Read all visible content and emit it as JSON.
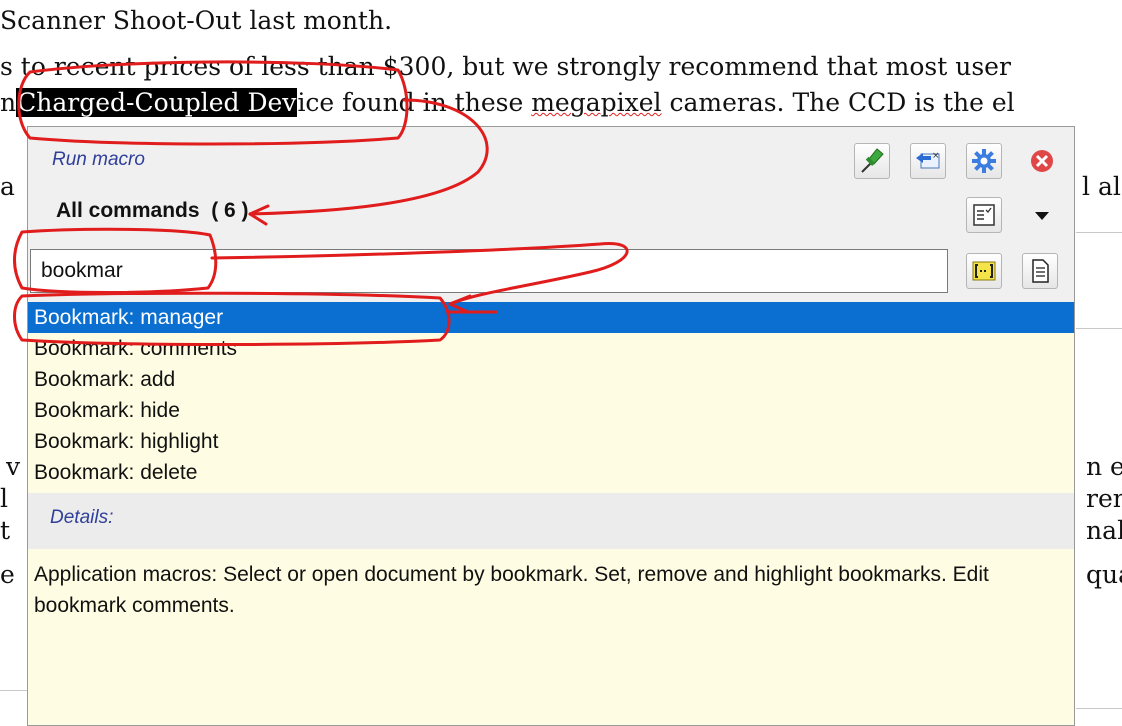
{
  "document": {
    "line1": "Scanner Shoot-Out last month.",
    "line2": "s to recent prices of less than $300, but we strongly recommend that most user",
    "line3_prefix": "n",
    "line3_selected": "Charged-Coupled Dev",
    "line3_mid": "ice found in these ",
    "line3_squiggle": "megapixel",
    "line3_suffix": " cameras. The CCD is the el",
    "frag_left_4": "a",
    "frag_right_4": "l als",
    "frag_left_5": "v",
    "frag_right_5": "n ec",
    "frag_left_6": "l",
    "frag_right_6": "ren",
    "frag_left_7": "t",
    "frag_right_7": "nah",
    "frag_left_8": "e",
    "frag_right_8": "qua"
  },
  "panel": {
    "title": "Run macro",
    "list_header": "All commands",
    "list_count": "( 6 )",
    "search_value": "bookmar",
    "commands": [
      "Bookmark: manager",
      "Bookmark: comments",
      "Bookmark: add",
      "Bookmark: hide",
      "Bookmark: highlight",
      "Bookmark: delete"
    ],
    "details_label": "Details:",
    "description": "Application macros: Select or open document by bookmark. Set, remove and highlight bookmarks. Edit bookmark comments."
  },
  "icons": {
    "pin": "pin-icon",
    "back": "back-arrow-icon",
    "settings": "gear-icon",
    "close": "close-icon",
    "list_options": "list-options-icon",
    "dropdown": "chevron-down-icon",
    "bracket": "bracket-icon",
    "document": "document-icon"
  },
  "colors": {
    "selection": "#0a6fd0",
    "panel_bg": "#fefde3",
    "header_bg": "#f0f0f0",
    "label_blue": "#2f3f9a",
    "annotation_red": "#e01c1c"
  }
}
